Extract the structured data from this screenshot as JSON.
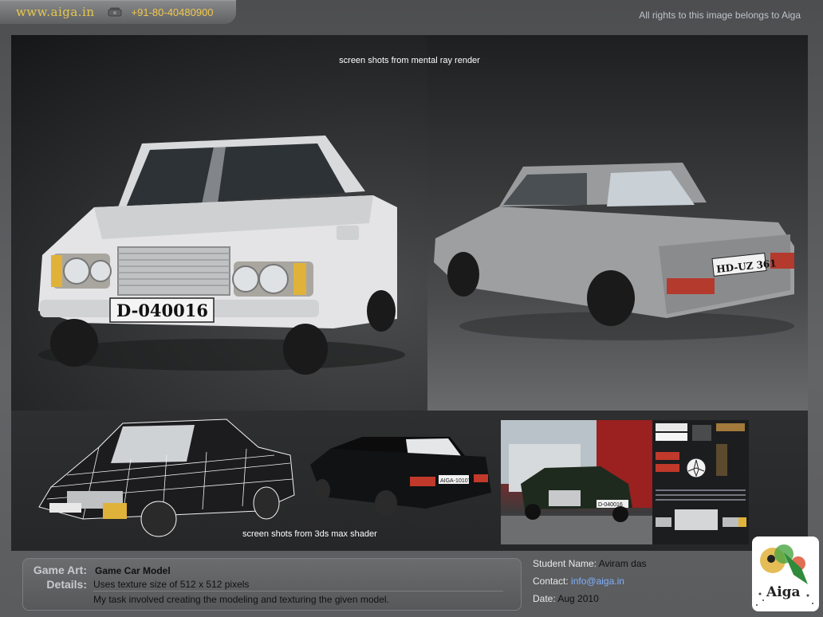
{
  "header": {
    "site": "www.aiga.in",
    "phone": "+91-80-40480900",
    "rights": "All rights to this image belongs to Aiga"
  },
  "render": {
    "caption": "screen shots from mental ray render",
    "front_plate": "D-040016",
    "rear_plate": "HD-UZ 361"
  },
  "shader": {
    "caption": "screen shots from 3ds max shader",
    "plate_text": "AIGA-101070",
    "photo_plate": "D-040016"
  },
  "info": {
    "game_art_label": "Game Art:",
    "game_art_value": "Game Car Model",
    "details_label": "Details:",
    "details_line1": "Uses texture size of 512 x 512 pixels",
    "details_line2": "My task involved creating the modeling and texturing the given model."
  },
  "student": {
    "name_label": "Student Name:",
    "name_value": "Aviram das",
    "contact_label": "Contact:",
    "contact_value": "info@aiga.in",
    "date_label": "Date:",
    "date_value": "Aug 2010"
  },
  "logo": {
    "text": "Aiga"
  },
  "colors": {
    "accent_gold": "#e6c74c",
    "email_blue": "#7fb0ff"
  }
}
